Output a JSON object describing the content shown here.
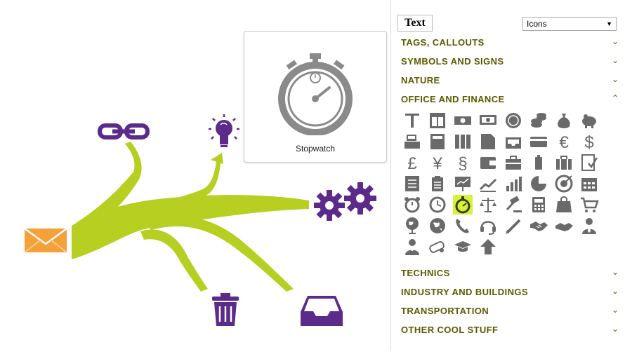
{
  "tooltip": {
    "title": "Stopwatch"
  },
  "panel": {
    "text_button": "Text",
    "dropdown": {
      "selected": "Icons"
    },
    "categories_top": [
      {
        "label": "TAGS, CALLOUTS",
        "state": "collapsed"
      },
      {
        "label": "SYMBOLS AND SIGNS",
        "state": "collapsed"
      },
      {
        "label": "NATURE",
        "state": "collapsed"
      },
      {
        "label": "OFFICE AND FINANCE",
        "state": "expanded"
      }
    ],
    "categories_bottom": [
      {
        "label": "TECHNICS",
        "state": "collapsed"
      },
      {
        "label": "INDUSTRY AND BUILDINGS",
        "state": "collapsed"
      },
      {
        "label": "TRANSPORTATION",
        "state": "collapsed"
      },
      {
        "label": "OTHER COOL STUFF",
        "state": "collapsed"
      }
    ],
    "office_icons": [
      [
        "text-cursor",
        "layout",
        "banknote",
        "money",
        "coin",
        "coins-stack",
        "money-bag",
        "piggy-bank"
      ],
      [
        "cash-register",
        "book",
        "binders",
        "folder",
        "inbox-tray",
        "credit-card",
        "euro",
        "dollar"
      ],
      [
        "pound",
        "yen",
        "section",
        "wallet",
        "briefcase",
        "paper-bin",
        "case",
        "checklist"
      ],
      [
        "checklist-2",
        "clipboard",
        "presentation",
        "line-chart",
        "bar-chart",
        "pie-chart",
        "target",
        "calendar"
      ],
      [
        "alarm-clock",
        "clock",
        "stopwatch",
        "scales",
        "gavel",
        "calculator",
        "shopping-bag",
        "shopping-cart"
      ],
      [
        "globe",
        "globe-2",
        "phone",
        "headset",
        "pen",
        "handshake",
        "handshake-2",
        "businessman"
      ],
      [
        "user-tie",
        "diploma",
        "graduation-cap",
        "up-arrow"
      ]
    ],
    "selected_icon": "stopwatch"
  },
  "colors": {
    "accent_green": "#b6cf1f",
    "icon_purple": "#5b2a8a",
    "envelope_orange": "#f5a13a",
    "category_text": "#5a5a00",
    "selection_bg": "#d7f23d"
  }
}
